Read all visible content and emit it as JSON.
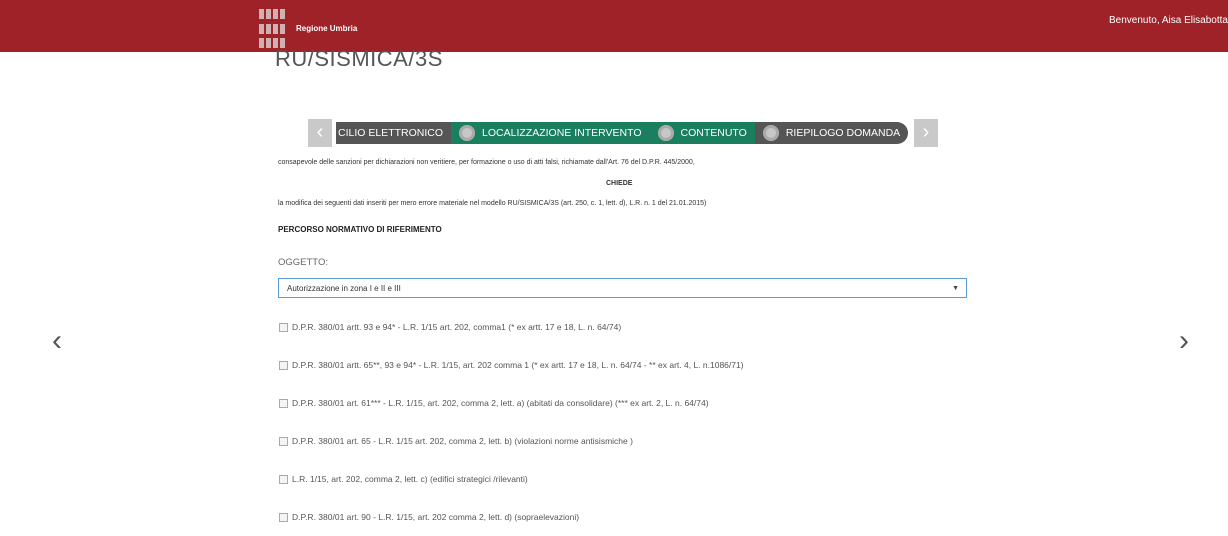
{
  "header": {
    "brand": "Regione Umbria",
    "welcome": "Benvenuto, Aisa Elisabotta"
  },
  "page": {
    "code": "RU/SISMICA/3S"
  },
  "wizard": {
    "steps": [
      {
        "label": "CILIO ELETTRONICO",
        "active": false
      },
      {
        "label": "LOCALIZZAZIONE INTERVENTO",
        "active": true
      },
      {
        "label": "CONTENUTO",
        "active": true
      },
      {
        "label": "RIEPILOGO DOMANDA",
        "active": false
      }
    ],
    "prev_icon": "chevron-left-icon",
    "next_icon": "chevron-right-icon"
  },
  "content": {
    "declaration": "consapevole delle sanzioni per dichiarazioni non veritiere, per formazione o uso di atti falsi, richiamate dall'Art. 76 del D.P.R. 445/2000,",
    "chiede": "CHIEDE",
    "modification": "la modifica dei seguenti dati inseriti per mero errore materiale nel modello RU/SISMICA/3S (art. 250, c. 1, lett. d), L.R. n. 1 del 21.01.2015)",
    "percorso_title": "PERCORSO NORMATIVO DI RIFERIMENTO",
    "oggetto_label": "OGGETTO:",
    "oggetto_value": "Autorizzazione in zona I e II e III",
    "checkboxes": [
      "D.P.R. 380/01 artt. 93 e 94* - L.R. 1/15 art. 202, comma1 (* ex artt. 17 e 18, L. n. 64/74)",
      "D.P.R. 380/01 artt. 65**, 93 e 94* - L.R. 1/15, art. 202 comma 1 (* ex artt. 17 e 18, L. n. 64/74 - ** ex art. 4, L. n.1086/71)",
      "D.P.R. 380/01 art. 61*** - L.R. 1/15, art. 202, comma 2, lett. a) (abitati da consolidare) (*** ex art. 2, L. n. 64/74)",
      "D.P.R. 380/01 art. 65 - L.R. 1/15 art. 202, comma 2, lett. b) (violazioni norme antisismiche )",
      "L.R. 1/15, art. 202, comma 2, lett. c) (edifici strategici /rilevanti)",
      "D.P.R. 380/01 art. 90 - L.R. 1/15, art. 202 comma 2, lett. d) (sopraelevazioni)"
    ]
  }
}
